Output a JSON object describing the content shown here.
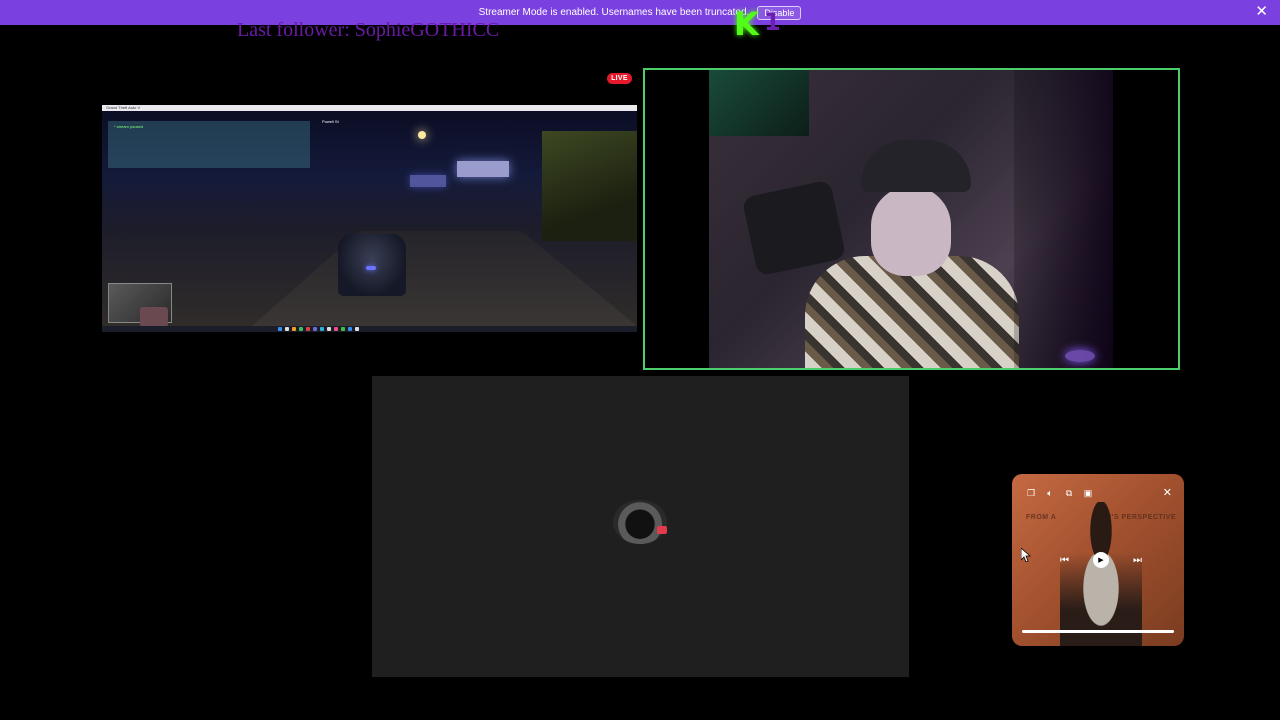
{
  "banner": {
    "message": "Streamer Mode is enabled. Usernames have been truncated.",
    "button_label": "Disable",
    "close_icon": "close-icon",
    "color": "#7b40e0"
  },
  "overlay": {
    "kick_logo_letter": "K",
    "kick_logo_number": "1",
    "last_follower": "Last follower: SophieGOTHICC",
    "live_badge": "LIVE",
    "webcam_border_color": "#4ccf6a"
  },
  "game": {
    "titlebar": "Grand Theft Auto V",
    "chat_text": "* stream paused",
    "hud_text": "Powell St"
  },
  "media_player": {
    "art_text_left": "FROM A",
    "art_text_right": "MAN'S PERSPECTIVE",
    "icons": [
      "miniplayer-icon",
      "volume-icon",
      "copy-icon",
      "pin-icon",
      "close-icon",
      "previous-icon",
      "play-icon",
      "next-icon"
    ],
    "progress": 1.0
  }
}
